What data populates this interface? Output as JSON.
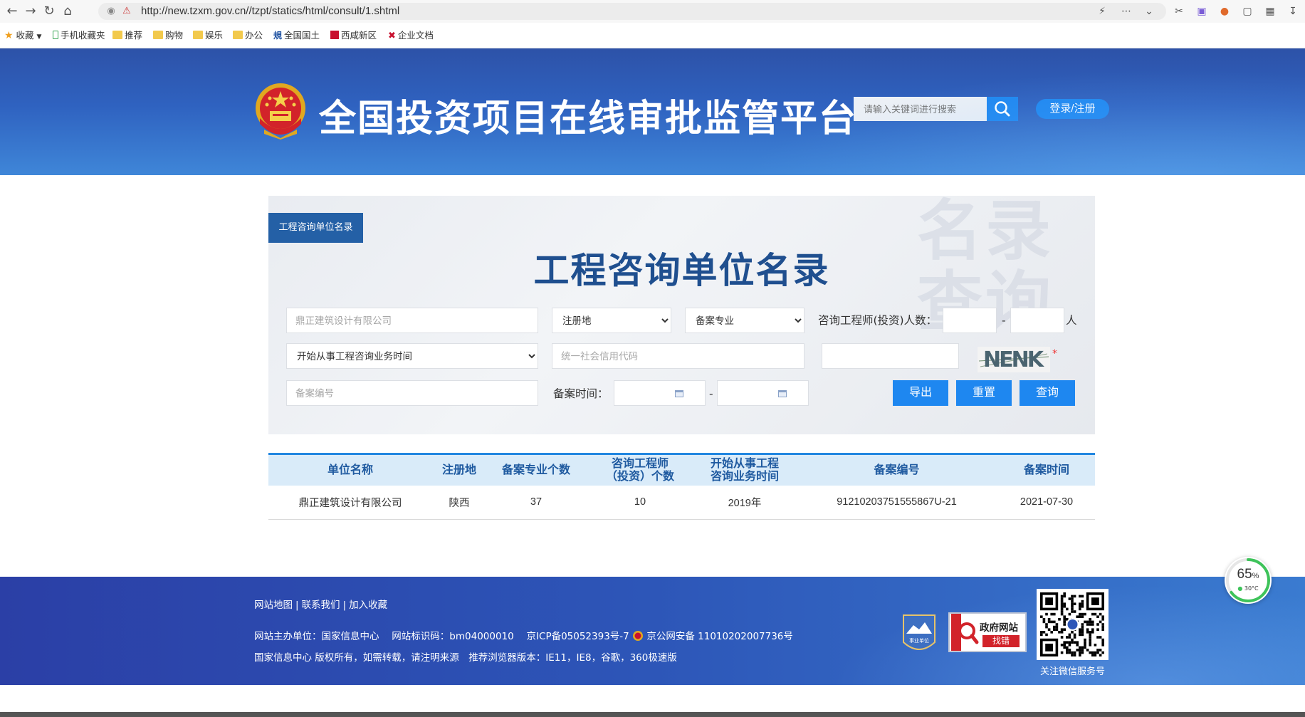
{
  "browser": {
    "url": "http://new.tzxm.gov.cn//tzpt/statics/html/consult/1.shtml",
    "bookmarks": [
      "收藏",
      "手机收藏夹",
      "推荐",
      "购物",
      "娱乐",
      "办公",
      "全国国土",
      "西咸新区",
      "企业文档"
    ]
  },
  "header": {
    "title": "全国投资项目在线审批监管平台",
    "search_placeholder": "请输入关键词进行搜索",
    "login_label": "登录/注册"
  },
  "panel": {
    "tab_label": "工程咨询单位名录",
    "heading": "工程咨询单位名录",
    "watermark": "名录查询",
    "company_placeholder": "鼎正建筑设计有限公司",
    "region_selected": "注册地",
    "specialty_selected": "备案专业",
    "engineer_count_label": "咨询工程师(投资)人数：",
    "range_dash": "-",
    "unit_person": "人",
    "start_time_selected": "开始从事工程咨询业务时间",
    "credit_code_placeholder": "统一社会信用代码",
    "captcha_text": "NENK",
    "required_mark": "*",
    "record_no_placeholder": "备案编号",
    "record_time_label": "备案时间：",
    "buttons": {
      "export": "导出",
      "reset": "重置",
      "query": "查询"
    }
  },
  "table": {
    "headers": [
      "单位名称",
      "注册地",
      "备案专业个数",
      "咨询工程师\n（投资）个数",
      "开始从事工程\n咨询业务时间",
      "备案编号",
      "备案时间"
    ],
    "rows": [
      [
        "鼎正建筑设计有限公司",
        "陕西",
        "37",
        "10",
        "2019年",
        "91210203751555867U-21",
        "2021-07-30"
      ]
    ]
  },
  "footer": {
    "links": [
      "网站地图",
      "联系我们",
      "加入收藏"
    ],
    "link_sep": "|",
    "line1_parts": {
      "host": "网站主办单位：国家信息中心",
      "site_id": "网站标识码：bm04000010",
      "icp": "京ICP备05052393号-7",
      "police": "京公网安备 11010202007736号"
    },
    "line2": "国家信息中心 版权所有，如需转载，请注明来源　推荐浏览器版本：IE11，IE8，谷歌，360极速版",
    "badge_unit_text": "事业单位",
    "gov_badge_line1": "政府网站",
    "gov_badge_line2": "找错",
    "qr_caption": "关注微信服务号"
  },
  "widget": {
    "percent": "65",
    "percent_sign": "%",
    "temperature": "30°C",
    "level": 0.65
  },
  "colors": {
    "header_blue": "#2f62c0",
    "accent": "#1e87f0",
    "title_navy": "#1f4f8f",
    "table_head": "#d9ebf9"
  }
}
